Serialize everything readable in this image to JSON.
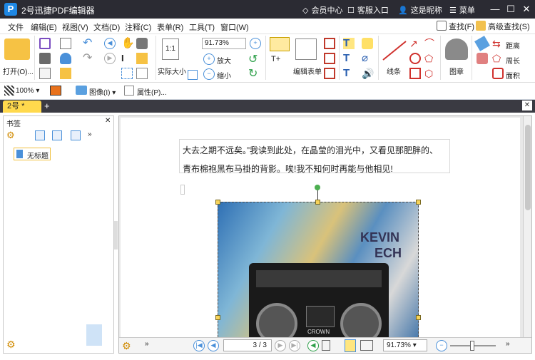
{
  "app": {
    "title": "2号迅捷PDF编辑器",
    "logo": "P"
  },
  "titlebar": {
    "member": "会员中心",
    "support": "客服入口",
    "user": "这是昵称",
    "menu": "菜单"
  },
  "menubar": [
    "文件",
    "编辑(E)",
    "视图(V)",
    "文档(D)",
    "注释(C)",
    "表单(R)",
    "工具(T)",
    "窗口(W)"
  ],
  "menubar_right": {
    "find": "查找(F)",
    "adv_find": "高级查找(S)"
  },
  "ribbon": {
    "open": "打开(O)...",
    "actual_size": "实际大小",
    "zoom_value": "91.73%",
    "zoom_in": "放大",
    "zoom_out": "缩小",
    "edit_form": "编辑表单",
    "line": "线条",
    "stamp": "图章",
    "distance": "距离",
    "perimeter": "周长",
    "area": "面积"
  },
  "toolbar2": {
    "zoom": "100%",
    "image": "图像(I)",
    "properties": "属性(P)..."
  },
  "tabs": {
    "doc_tab": "2号 *"
  },
  "bookmarks": {
    "title": "书签",
    "item": "无标题"
  },
  "document": {
    "line1": "大去之期不远矣。”我读到此处，在晶莹的泪光中，又看见那肥胖的、",
    "line2": "青布棉袍黑布马褂的背影。唉!我不知何时再能与他相见!",
    "image_text1": "KEVIN",
    "image_text2": "ECH",
    "image_text3": "CROWN"
  },
  "bottom": {
    "page_value": "3",
    "page_total": "/ 3",
    "zoom_value": "91.73%"
  },
  "colors": {
    "accent": "#4a90d9",
    "title_bg": "#2b2b33",
    "tab_active": "#ffd94d",
    "panel_border": "#c8c8c8"
  }
}
